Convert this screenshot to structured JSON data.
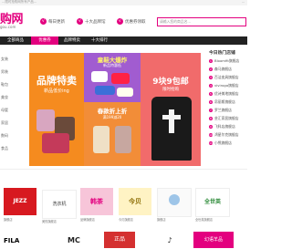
{
  "topbar": {
    "left": "...限时抢购网所有产品...",
    "right": "..."
  },
  "logo": {
    "text": "购网",
    "sub": "gou.com"
  },
  "features": [
    {
      "icon": "√",
      "label": "每日更新"
    },
    {
      "icon": "√",
      "label": "十大品牌馆"
    },
    {
      "icon": "√",
      "label": "优惠券领取"
    }
  ],
  "search": {
    "placeholder": "请输入您的商品名..."
  },
  "nav": [
    "全部商品",
    "优惠券",
    "品牌特卖",
    "十大排行"
  ],
  "leftcol": [
    "女装",
    "男装",
    "鞋包",
    "美妆",
    "母婴",
    "家居",
    "数码",
    "食品"
  ],
  "banner": {
    "p1_title": "品牌特卖",
    "p1_sub": "新品低价ing",
    "p2_title": "童鞋大爆炸",
    "p2_sub": "新品特惠低",
    "p2_title2": "春款折上折",
    "p2_sub2": "满199减20",
    "p3_title": "9块9包邮",
    "p3_sub": "限时抢购"
  },
  "hotlist": {
    "title": "今日热门店铺",
    "items": [
      "Bloomfit旗舰店",
      "森马旗舰店",
      "百洁皮具旗舰店",
      "viviroga旗舰店",
      "优诗美地旗舰店",
      "帛丽斯旗舰店",
      "罗兰旗舰店",
      "芸汇家居旗舰店",
      "飞科店旗舰店",
      "鸿星尔克旗舰店",
      "小熊旗舰店"
    ]
  },
  "brands": [
    {
      "name": "JEZZ",
      "cap": "旗舰店"
    },
    {
      "name": "洗衣机",
      "cap": "美的旗舰店"
    },
    {
      "name": "韩茶",
      "cap": "品牌旗舰店"
    },
    {
      "name": "今贝",
      "cap": "今贝旗舰店"
    },
    {
      "name": "",
      "cap": "旗舰店"
    },
    {
      "name": "全世英",
      "cap": "全世英旗舰店"
    }
  ],
  "brands2": [
    {
      "name": "FILA"
    },
    {
      "name": "MC"
    },
    {
      "name": "正品"
    },
    {
      "name": "♪"
    },
    {
      "name": "幻语羊品"
    }
  ],
  "colors": {
    "accent": "#e3007f",
    "nav": "#222222"
  }
}
